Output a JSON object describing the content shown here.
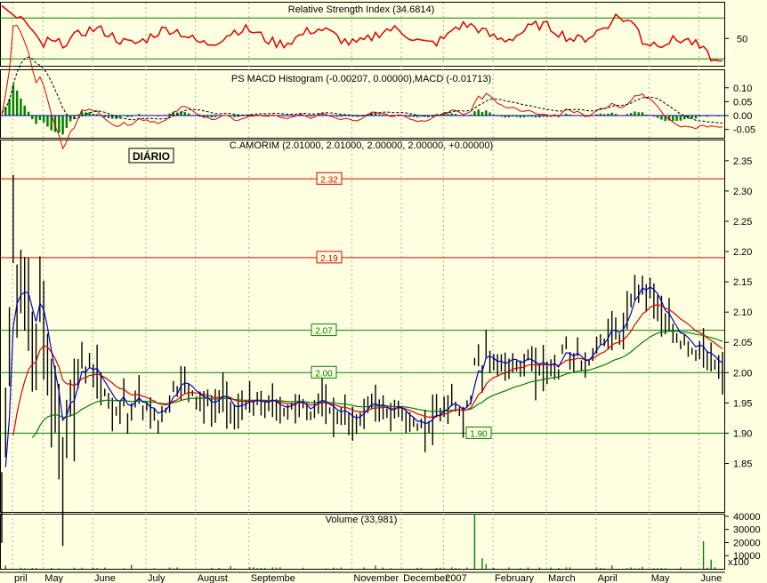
{
  "colors": {
    "background": "#FFFFE1",
    "rsi_line": "#E00000",
    "price_bar": "#000000",
    "price_ma_fast": "#0000CC",
    "price_ma_mid": "#E00000",
    "price_ma_slow": "#008000",
    "level_red": "#E00000",
    "level_green": "#008000",
    "volume": "#008000",
    "macd_hist": "#008000",
    "gridline": "#B0B0B0"
  },
  "chart_data": [
    {
      "type": "line",
      "panel": "rsi",
      "title": "Relative Strength Index (34.6814)",
      "ylim": [
        25,
        85
      ],
      "ticks": [
        "50"
      ],
      "reference_lines": [
        30,
        70
      ],
      "grid": true
    },
    {
      "type": "bar",
      "panel": "macd",
      "title": "PS MACD Histogram (-0.00207, 0.00000),MACD (-0.01713)",
      "ylim": [
        -0.08,
        0.16
      ],
      "ticks": [
        "0.10",
        "0.05",
        "0.00",
        "-0.05"
      ],
      "grid": true
    },
    {
      "type": "line",
      "panel": "price",
      "title": "C.AMORIM (2.01000, 2.01000, 2.00000, 2.00000, +0.00000)",
      "badge": "DIÁRIO",
      "ylim": [
        1.77,
        2.385
      ],
      "ticks": [
        "2.35",
        "2.30",
        "2.25",
        "2.20",
        "2.15",
        "2.10",
        "2.05",
        "2.00",
        "1.95",
        "1.90",
        "1.85"
      ],
      "levels": [
        {
          "value": 2.32,
          "label": "2.32",
          "color": "red"
        },
        {
          "value": 2.19,
          "label": "2.19",
          "color": "red"
        },
        {
          "value": 2.07,
          "label": "2.07",
          "color": "green"
        },
        {
          "value": 2.0,
          "label": "2.00",
          "color": "green"
        },
        {
          "value": 1.9,
          "label": "1.90",
          "color": "green"
        }
      ],
      "x": [
        "April",
        "May",
        "June",
        "July",
        "August",
        "September",
        "November",
        "December",
        "2007",
        "February",
        "March",
        "April",
        "May",
        "June"
      ],
      "anchors": [
        [
          0,
          1.78
        ],
        [
          1,
          1.94
        ],
        [
          2,
          2.05
        ],
        [
          3,
          2.3
        ],
        [
          4,
          2.17
        ],
        [
          5,
          2.15
        ],
        [
          6,
          2.14
        ],
        [
          7,
          2.13
        ],
        [
          8,
          2.07
        ],
        [
          9,
          2.05
        ],
        [
          10,
          2.16
        ],
        [
          11,
          2.09
        ],
        [
          12,
          2.03
        ],
        [
          13,
          1.98
        ],
        [
          14,
          1.95
        ],
        [
          15,
          1.92
        ],
        [
          16,
          1.85
        ],
        [
          17,
          1.94
        ],
        [
          18,
          1.98
        ],
        [
          19,
          1.96
        ],
        [
          20,
          2.01
        ],
        [
          21,
          2.04
        ],
        [
          22,
          2.0
        ],
        [
          23,
          2.02
        ],
        [
          24,
          2.0
        ],
        [
          25,
          2.01
        ],
        [
          26,
          1.98
        ],
        [
          27,
          1.97
        ],
        [
          28,
          1.96
        ],
        [
          29,
          1.95
        ],
        [
          30,
          1.94
        ],
        [
          31,
          1.95
        ],
        [
          32,
          1.97
        ],
        [
          33,
          1.93
        ],
        [
          34,
          1.94
        ],
        [
          35,
          1.96
        ],
        [
          36,
          1.97
        ],
        [
          37,
          1.94
        ],
        [
          38,
          1.95
        ],
        [
          39,
          1.93
        ],
        [
          40,
          1.94
        ],
        [
          41,
          1.92
        ],
        [
          42,
          1.94
        ],
        [
          43,
          1.94
        ],
        [
          44,
          1.96
        ],
        [
          45,
          1.98
        ],
        [
          46,
          1.97
        ],
        [
          47,
          2.0
        ],
        [
          48,
          1.99
        ],
        [
          49,
          1.98
        ],
        [
          50,
          1.97
        ],
        [
          51,
          1.96
        ],
        [
          52,
          1.96
        ],
        [
          53,
          1.95
        ],
        [
          54,
          1.96
        ],
        [
          55,
          1.94
        ],
        [
          56,
          1.95
        ],
        [
          57,
          1.96
        ],
        [
          58,
          1.97
        ],
        [
          59,
          1.96
        ],
        [
          60,
          1.95
        ],
        [
          61,
          1.93
        ],
        [
          62,
          1.94
        ],
        [
          63,
          1.95
        ],
        [
          64,
          1.95
        ],
        [
          65,
          1.96
        ],
        [
          66,
          1.95
        ],
        [
          67,
          1.96
        ],
        [
          68,
          1.95
        ],
        [
          69,
          1.95
        ],
        [
          70,
          1.95
        ],
        [
          71,
          1.96
        ],
        [
          72,
          1.95
        ],
        [
          73,
          1.94
        ],
        [
          74,
          1.94
        ],
        [
          75,
          1.94
        ],
        [
          76,
          1.95
        ],
        [
          77,
          1.95
        ],
        [
          78,
          1.96
        ],
        [
          79,
          1.95
        ],
        [
          80,
          1.94
        ],
        [
          81,
          1.93
        ],
        [
          82,
          1.95
        ],
        [
          83,
          1.96
        ],
        [
          84,
          1.96
        ],
        [
          85,
          1.95
        ],
        [
          86,
          1.94
        ],
        [
          87,
          1.94
        ],
        [
          88,
          1.93
        ],
        [
          89,
          1.93
        ],
        [
          90,
          1.94
        ],
        [
          91,
          1.93
        ],
        [
          92,
          1.92
        ],
        [
          93,
          1.92
        ],
        [
          94,
          1.93
        ],
        [
          95,
          1.94
        ],
        [
          96,
          1.95
        ],
        [
          97,
          1.96
        ],
        [
          98,
          1.95
        ],
        [
          99,
          1.94
        ],
        [
          100,
          1.95
        ],
        [
          101,
          1.94
        ],
        [
          102,
          1.93
        ],
        [
          103,
          1.94
        ],
        [
          104,
          1.95
        ],
        [
          105,
          1.94
        ],
        [
          106,
          1.93
        ],
        [
          107,
          1.92
        ],
        [
          108,
          1.92
        ],
        [
          109,
          1.91
        ],
        [
          110,
          1.92
        ],
        [
          111,
          1.91
        ],
        [
          112,
          1.92
        ],
        [
          113,
          1.93
        ],
        [
          114,
          1.94
        ],
        [
          115,
          1.93
        ],
        [
          116,
          1.95
        ],
        [
          117,
          1.94
        ],
        [
          118,
          1.96
        ],
        [
          119,
          1.95
        ],
        [
          120,
          1.94
        ],
        [
          121,
          1.93
        ],
        [
          122,
          1.95
        ],
        [
          123,
          1.96
        ],
        [
          124,
          2.02
        ],
        [
          125,
          2.04
        ],
        [
          126,
          2.0
        ],
        [
          127,
          2.06
        ],
        [
          128,
          2.03
        ],
        [
          129,
          2.02
        ],
        [
          130,
          2.01
        ],
        [
          131,
          2.02
        ],
        [
          132,
          2.01
        ],
        [
          133,
          2.02
        ],
        [
          134,
          2.03
        ],
        [
          135,
          2.02
        ],
        [
          136,
          2.01
        ],
        [
          137,
          2.02
        ],
        [
          138,
          2.03
        ],
        [
          139,
          2.02
        ],
        [
          140,
          2.01
        ],
        [
          141,
          2.01
        ],
        [
          142,
          2.02
        ],
        [
          143,
          2.01
        ],
        [
          144,
          2.01
        ],
        [
          145,
          2.02
        ],
        [
          146,
          2.0
        ],
        [
          147,
          2.04
        ],
        [
          148,
          2.05
        ],
        [
          149,
          2.03
        ],
        [
          150,
          2.02
        ],
        [
          151,
          2.04
        ],
        [
          152,
          2.02
        ],
        [
          153,
          2.01
        ],
        [
          154,
          2.02
        ],
        [
          155,
          2.04
        ],
        [
          156,
          2.05
        ],
        [
          157,
          2.06
        ],
        [
          158,
          2.05
        ],
        [
          159,
          2.07
        ],
        [
          160,
          2.09
        ],
        [
          161,
          2.07
        ],
        [
          162,
          2.06
        ],
        [
          163,
          2.08
        ],
        [
          164,
          2.1
        ],
        [
          165,
          2.12
        ],
        [
          166,
          2.15
        ],
        [
          167,
          2.14
        ],
        [
          168,
          2.16
        ],
        [
          169,
          2.13
        ],
        [
          170,
          2.15
        ],
        [
          171,
          2.13
        ],
        [
          172,
          2.12
        ],
        [
          173,
          2.1
        ],
        [
          174,
          2.08
        ],
        [
          175,
          2.09
        ],
        [
          176,
          2.07
        ],
        [
          177,
          2.06
        ],
        [
          178,
          2.05
        ],
        [
          179,
          2.06
        ],
        [
          180,
          2.05
        ],
        [
          181,
          2.04
        ],
        [
          182,
          2.03
        ],
        [
          183,
          2.05
        ],
        [
          184,
          2.04
        ],
        [
          185,
          2.02
        ],
        [
          186,
          2.03
        ],
        [
          187,
          2.02
        ],
        [
          188,
          2.01
        ],
        [
          189,
          2.01
        ]
      ],
      "grid": true
    },
    {
      "type": "bar",
      "panel": "volume",
      "title": "Volume (33,981)",
      "ylim": [
        0,
        42000
      ],
      "ticks": [
        "40000",
        "30000",
        "20000",
        "10000"
      ],
      "unit_label": "x100",
      "spikes": [
        [
          1,
          2500
        ],
        [
          34,
          3000
        ],
        [
          60,
          2000
        ],
        [
          98,
          2500
        ],
        [
          124,
          42000
        ],
        [
          126,
          8000
        ],
        [
          127,
          3500
        ],
        [
          160,
          2500
        ],
        [
          168,
          1500
        ],
        [
          184,
          21000
        ],
        [
          186,
          7000
        ]
      ],
      "grid": true
    }
  ],
  "x_axis": {
    "labels": [
      {
        "label": "April",
        "display": "pril",
        "day": 0
      },
      {
        "label": "May",
        "display": "May",
        "day": 8
      },
      {
        "label": "June",
        "display": "June",
        "day": 21
      },
      {
        "label": "July",
        "display": "July",
        "day": 35
      },
      {
        "label": "August",
        "display": "August",
        "day": 48
      },
      {
        "label": "September",
        "display": "Septembe",
        "day": 62
      },
      {
        "label": "November",
        "display": "November",
        "day": 89
      },
      {
        "label": "December",
        "display": "December",
        "day": 102
      },
      {
        "label": "2007",
        "display": "2007",
        "day": 113
      },
      {
        "label": "February",
        "display": "February",
        "day": 126
      },
      {
        "label": "March",
        "display": "March",
        "day": 140
      },
      {
        "label": "April",
        "display": "April",
        "day": 153
      },
      {
        "label": "May",
        "display": "May",
        "day": 167
      },
      {
        "label": "June",
        "display": "June",
        "day": 180
      }
    ]
  }
}
